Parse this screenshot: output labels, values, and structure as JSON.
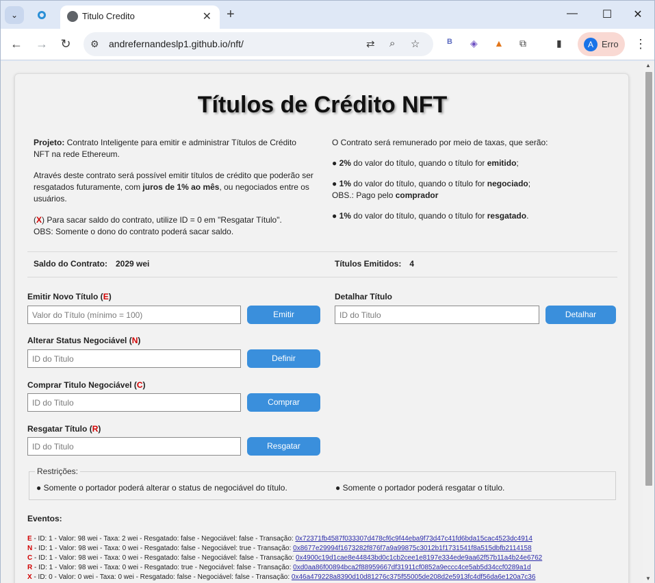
{
  "browser": {
    "tab_title": "Titulo Credito",
    "url": "andrefernandeslp1.github.io/nft/",
    "profile_initial": "A",
    "profile_label": "Erro"
  },
  "page": {
    "title": "Títulos de Crédito NFT",
    "intro_left": {
      "p1_bold": "Projeto:",
      "p1_text": " Contrato Inteligente para emitir e administrar Títulos de Crédito NFT na rede Ethereum.",
      "p2_a": "Através deste contrato será possível emitir títulos de crédito que poderão ser resgatados futuramente, com ",
      "p2_bold": "juros de 1% ao mês",
      "p2_b": ", ou negociados entre os usuários.",
      "p3_open": "(",
      "p3_x": "X",
      "p3_text": ") Para sacar saldo do contrato, utilize ID = 0 em \"Resgatar Título\".",
      "p3_obs": "OBS: Somente o dono do contrato poderá sacar saldo."
    },
    "intro_right": {
      "heading": "O Contrato será remunerado por meio de taxas, que serão:",
      "fee1_pct": "● 2%",
      "fee1_text": " do valor do título, quando o título for ",
      "fee1_bold": "emitido",
      "fee1_end": ";",
      "fee2_pct": "● 1%",
      "fee2_text": " do valor do título, quando o título for ",
      "fee2_bold": "negociado",
      "fee2_end": ";",
      "fee2_obs": "OBS.: Pago pelo ",
      "fee2_obs_bold": "comprador",
      "fee3_pct": "● 1%",
      "fee3_text": " do valor do título, quando o título for ",
      "fee3_bold": "resgatado",
      "fee3_end": "."
    },
    "stats": {
      "balance_label": "Saldo do Contrato:",
      "balance_value": "2029 wei",
      "issued_label": "Títulos Emitidos:",
      "issued_value": "4"
    },
    "forms": {
      "emit": {
        "label": "Emitir Novo Título",
        "letter": "E",
        "placeholder": "Valor do Título (mínimo = 100)",
        "button": "Emitir"
      },
      "detail": {
        "label": "Detalhar Título",
        "placeholder": "ID do Titulo",
        "button": "Detalhar"
      },
      "status": {
        "label": "Alterar Status Negociável",
        "letter": "N",
        "placeholder": "ID do Titulo",
        "button": "Definir"
      },
      "buy": {
        "label": "Comprar Titulo Negociável",
        "letter": "C",
        "placeholder": "ID do Titulo",
        "button": "Comprar"
      },
      "redeem": {
        "label": "Resgatar Título",
        "letter": "R",
        "placeholder": "ID do Titulo",
        "button": "Resgatar"
      }
    },
    "restrictions": {
      "legend": "Restrições:",
      "item1": "● Somente o portador poderá alterar o status de negociável do título.",
      "item2": "● Somente o portador poderá resgatar o título."
    },
    "events_label": "Eventos:",
    "events": [
      {
        "letter": "E",
        "text": " - ID: 1 - Valor: 98 wei - Taxa: 2 wei - Resgatado: false - Negociável: false - Transação: ",
        "tx": "0x72371fb4587f033307d478cf6c9f44eba9f73d47c41fd6bda15cac4523dc4914"
      },
      {
        "letter": "N",
        "text": " - ID: 1 - Valor: 98 wei - Taxa: 0 wei - Resgatado: false - Negociável: true - Transação: ",
        "tx": "0x8677e29994f1673282f876f7a9a99875c3012b1f1731541f8a515dbfb2114158"
      },
      {
        "letter": "C",
        "text": " - ID: 1 - Valor: 98 wei - Taxa: 0 wei - Resgatado: false - Negociável: false - Transação: ",
        "tx": "0x4900c19d1cae8e44843bd0c1cb2cee1e8197e334ede9aa62f57b11a4b24e6762"
      },
      {
        "letter": "R",
        "text": " - ID: 1 - Valor: 98 wei - Taxa: 0 wei - Resgatado: true - Negociável: false - Transação: ",
        "tx": "0xd0aa86f00894bca2f88959667df31911cf0852a9eccc4ce5ab5d34ccf0289a1d"
      },
      {
        "letter": "X",
        "text": " - ID: 0 - Valor: 0 wei - Taxa: 0 wei - Resgatado: false - Negociável: false - Transação: ",
        "tx": "0x46a479228a8390d10d81276c375f55005de208d2e5913fc4df56da6e120a7c36"
      }
    ]
  }
}
